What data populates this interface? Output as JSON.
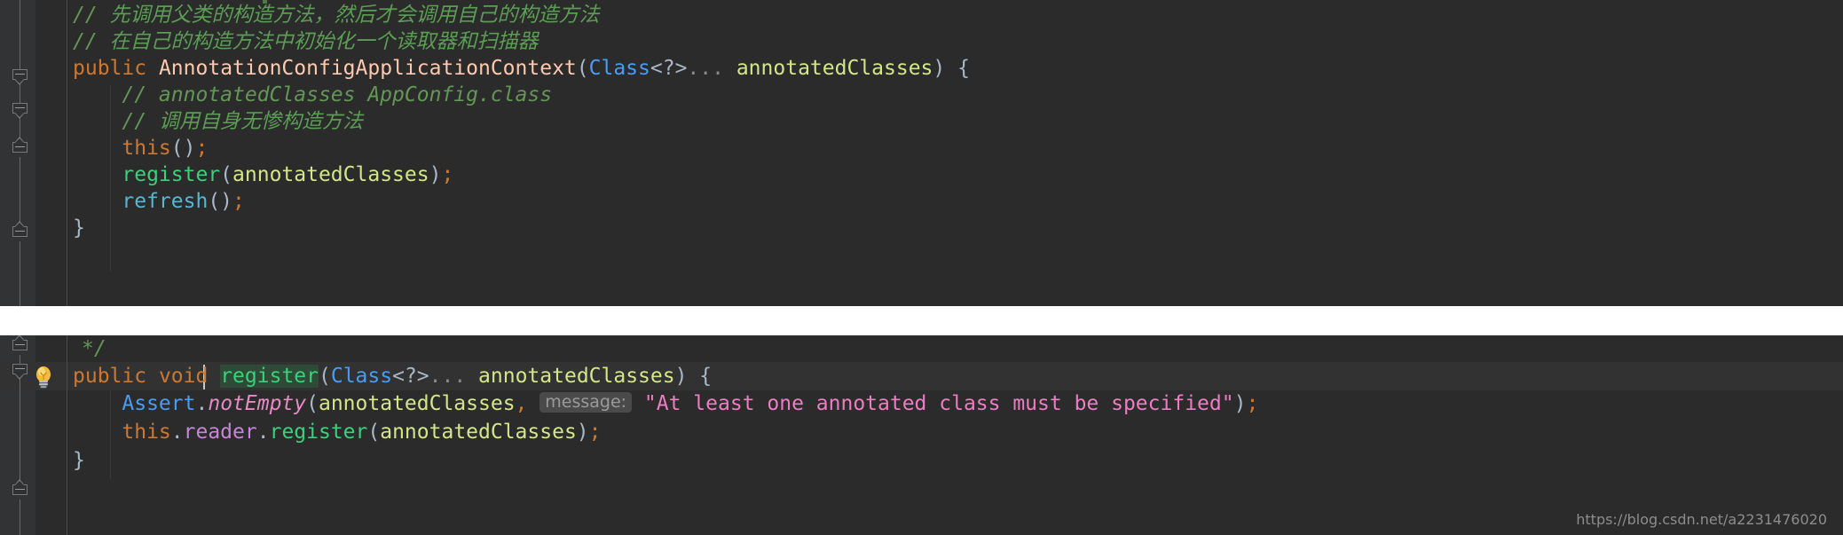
{
  "meta": {
    "editor": "java-code-editor",
    "theme_background": "#2b2b2b",
    "gutter_background": "#313335",
    "caret_row_background": "#323232",
    "accent_selection": "#2f4a36"
  },
  "watermark": {
    "text": "https://blog.csdn.net/a2231476020"
  },
  "top_pane": {
    "lines": [
      {
        "id": "line-comment-cjk-1",
        "indent": 4,
        "tokens": [
          {
            "kind": "comment",
            "text": "// "
          },
          {
            "kind": "comment-cjk",
            "text": "先调用父类的构造方法，然后才会调用自己的构造方法"
          }
        ]
      },
      {
        "id": "line-comment-cjk-2",
        "indent": 4,
        "tokens": [
          {
            "kind": "comment",
            "text": "// "
          },
          {
            "kind": "comment-cjk",
            "text": "在自己的构造方法中初始化一个读取器和扫描器"
          }
        ]
      },
      {
        "id": "line-constructor-signature",
        "indent": 4,
        "tokens": [
          {
            "kind": "keyword",
            "text": "public"
          },
          {
            "kind": "plain",
            "text": " "
          },
          {
            "kind": "type",
            "text": "AnnotationConfigApplicationContext"
          },
          {
            "kind": "plain",
            "text": "("
          },
          {
            "kind": "class",
            "text": "Class"
          },
          {
            "kind": "plain",
            "text": "<?>"
          },
          {
            "kind": "ellipsis",
            "text": "..."
          },
          {
            "kind": "plain",
            "text": " "
          },
          {
            "kind": "param",
            "text": "annotatedClasses"
          },
          {
            "kind": "plain",
            "text": ") {"
          }
        ]
      },
      {
        "id": "line-comment-appconfig",
        "indent": 8,
        "tokens": [
          {
            "kind": "comment",
            "text": "// annotatedClasses AppConfig.class"
          }
        ]
      },
      {
        "id": "line-comment-cjk-3",
        "indent": 8,
        "tokens": [
          {
            "kind": "comment",
            "text": "// "
          },
          {
            "kind": "comment-cjk",
            "text": "调用自身无惨构造方法"
          }
        ]
      },
      {
        "id": "line-this-call",
        "indent": 8,
        "tokens": [
          {
            "kind": "keyword",
            "text": "this"
          },
          {
            "kind": "plain",
            "text": "()"
          },
          {
            "kind": "semicolon",
            "text": ";"
          }
        ]
      },
      {
        "id": "line-register-call",
        "indent": 8,
        "tokens": [
          {
            "kind": "method",
            "text": "register"
          },
          {
            "kind": "plain",
            "text": "("
          },
          {
            "kind": "param",
            "text": "annotatedClasses"
          },
          {
            "kind": "plain",
            "text": ")"
          },
          {
            "kind": "semicolon",
            "text": ";"
          }
        ]
      },
      {
        "id": "line-refresh-call",
        "indent": 8,
        "tokens": [
          {
            "kind": "method-alt",
            "text": "refresh"
          },
          {
            "kind": "plain",
            "text": "()"
          },
          {
            "kind": "semicolon",
            "text": ";"
          }
        ]
      },
      {
        "id": "line-close-brace-top",
        "indent": 4,
        "tokens": [
          {
            "kind": "plain",
            "text": "}"
          }
        ]
      }
    ]
  },
  "bottom_pane": {
    "lines": [
      {
        "id": "line-javadoc-end",
        "indent": 5,
        "tokens": [
          {
            "kind": "comment",
            "text": "*/"
          }
        ]
      },
      {
        "id": "line-register-signature",
        "indent": 4,
        "highlighted": true,
        "tokens": [
          {
            "kind": "keyword",
            "text": "public"
          },
          {
            "kind": "plain",
            "text": " "
          },
          {
            "kind": "keyword",
            "text": "void"
          },
          {
            "kind": "plain",
            "text": " "
          },
          {
            "kind": "method-selected",
            "text": "register"
          },
          {
            "kind": "plain",
            "text": "("
          },
          {
            "kind": "class",
            "text": "Class"
          },
          {
            "kind": "plain",
            "text": "<?>"
          },
          {
            "kind": "ellipsis",
            "text": "..."
          },
          {
            "kind": "plain",
            "text": " "
          },
          {
            "kind": "param",
            "text": "annotatedClasses"
          },
          {
            "kind": "plain",
            "text": ") {"
          }
        ]
      },
      {
        "id": "line-assert-notempty",
        "indent": 8,
        "tokens": [
          {
            "kind": "class",
            "text": "Assert"
          },
          {
            "kind": "plain",
            "text": "."
          },
          {
            "kind": "static-method",
            "text": "notEmpty"
          },
          {
            "kind": "plain",
            "text": "("
          },
          {
            "kind": "param",
            "text": "annotatedClasses"
          },
          {
            "kind": "semicolon",
            "text": ","
          },
          {
            "kind": "plain",
            "text": " "
          },
          {
            "kind": "inlay-hint",
            "text": "message:"
          },
          {
            "kind": "plain",
            "text": " "
          },
          {
            "kind": "string",
            "text": "\"At least one annotated class must be specified\""
          },
          {
            "kind": "plain",
            "text": ")"
          },
          {
            "kind": "semicolon",
            "text": ";"
          }
        ]
      },
      {
        "id": "line-reader-register",
        "indent": 8,
        "tokens": [
          {
            "kind": "keyword",
            "text": "this"
          },
          {
            "kind": "plain",
            "text": "."
          },
          {
            "kind": "field",
            "text": "reader"
          },
          {
            "kind": "plain",
            "text": "."
          },
          {
            "kind": "method",
            "text": "register"
          },
          {
            "kind": "plain",
            "text": "("
          },
          {
            "kind": "param",
            "text": "annotatedClasses"
          },
          {
            "kind": "plain",
            "text": ")"
          },
          {
            "kind": "semicolon",
            "text": ";"
          }
        ]
      },
      {
        "id": "line-close-brace-bottom",
        "indent": 4,
        "tokens": [
          {
            "kind": "plain",
            "text": "}"
          }
        ]
      }
    ],
    "quick_fix": {
      "icon": "lightbulb-icon",
      "tooltip": "Show context actions"
    }
  }
}
